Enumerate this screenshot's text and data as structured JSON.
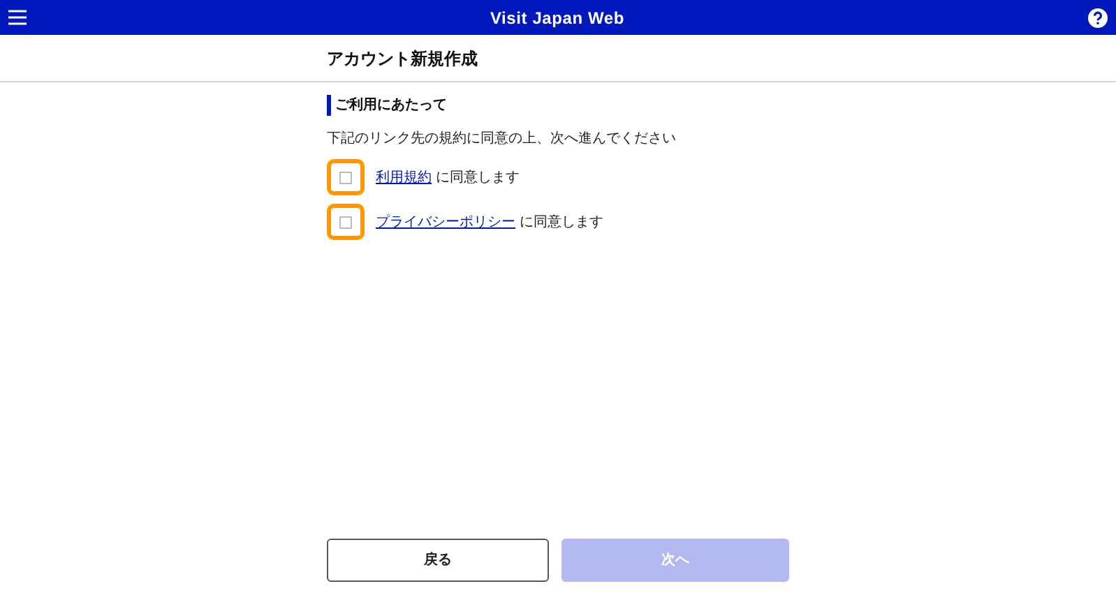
{
  "header": {
    "title": "Visit Japan Web"
  },
  "page_title": "アカウント新規作成",
  "section": {
    "heading": "ご利用にあたって",
    "instruction": "下記のリンク先の規約に同意の上、次へ進んでください"
  },
  "agreements": [
    {
      "link": "利用規約",
      "text": "に同意します",
      "checked": false
    },
    {
      "link": "プライバシーポリシー",
      "text": "に同意します",
      "checked": false
    }
  ],
  "buttons": {
    "back": {
      "label": "戻る",
      "disabled": false
    },
    "next": {
      "label": "次へ",
      "disabled": true
    }
  }
}
